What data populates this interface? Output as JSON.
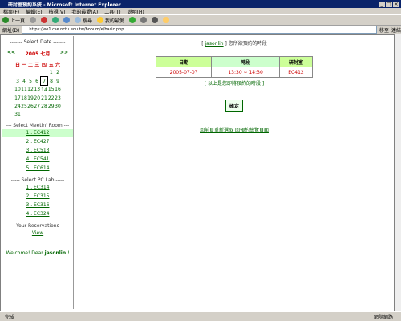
{
  "window": {
    "title": "研討室預約系統 - Microsoft Internet Explorer",
    "min": "_",
    "max": "□",
    "close": "×"
  },
  "menu": [
    "檔案(F)",
    "編輯(E)",
    "檢視(V)",
    "我的最愛(A)",
    "工具(T)",
    "說明(H)"
  ],
  "toolbar": {
    "back": "上一頁",
    "search": "搜尋",
    "favorites": "我的最愛"
  },
  "address": {
    "label": "網址(D)",
    "url": "https://ee1.cse.nctu.edu.tw/booum/e/basic.php",
    "go": "移至",
    "links": "連結"
  },
  "sidebar": {
    "select_date": "------- Select Date -------",
    "prev": "<<",
    "next": ">>",
    "month": "2005 七月",
    "weekdays": [
      "日",
      "一",
      "二",
      "三",
      "四",
      "五",
      "六"
    ],
    "weeks": [
      [
        "",
        "",
        "",
        "",
        "",
        "1",
        "2"
      ],
      [
        "3",
        "4",
        "5",
        "6",
        "7",
        "8",
        "9"
      ],
      [
        "10",
        "11",
        "12",
        "13",
        "14",
        "15",
        "16"
      ],
      [
        "17",
        "18",
        "19",
        "20",
        "21",
        "22",
        "23"
      ],
      [
        "24",
        "25",
        "26",
        "27",
        "28",
        "29",
        "30"
      ],
      [
        "31",
        "",
        "",
        "",
        "",
        "",
        ""
      ]
    ],
    "select_room": "--- Select Meetin' Room ---",
    "rooms": [
      "1 . EC412",
      "2 . EC427",
      "3 . EC513",
      "4 . EC541",
      "5 . EC614"
    ],
    "select_pc": "----- Select PC Lab -----",
    "pclabs": [
      "1 . EC314",
      "2 . EC315",
      "3 . EC316",
      "4 . EC324"
    ],
    "your_res": "--- Your Reservations ---",
    "view": "View",
    "welcome": "Welcome! Dear",
    "user": "jasonlin",
    "welcome_end": "!"
  },
  "main": {
    "header_pre": "[",
    "user": "jasonlin",
    "header_post": "] 您所欲預約的時段",
    "table_headers": [
      "日期",
      "時段",
      "研討室"
    ],
    "row": [
      "2005-07-07",
      "13:30 ~ 14:30",
      "EC412"
    ],
    "note": "[ 以上是您即將預約的時段 ]",
    "ok": "確定",
    "back": "回前頁重新選取 回預約總覽頁面"
  },
  "status": {
    "left": "完成",
    "zone": "網際網路"
  }
}
